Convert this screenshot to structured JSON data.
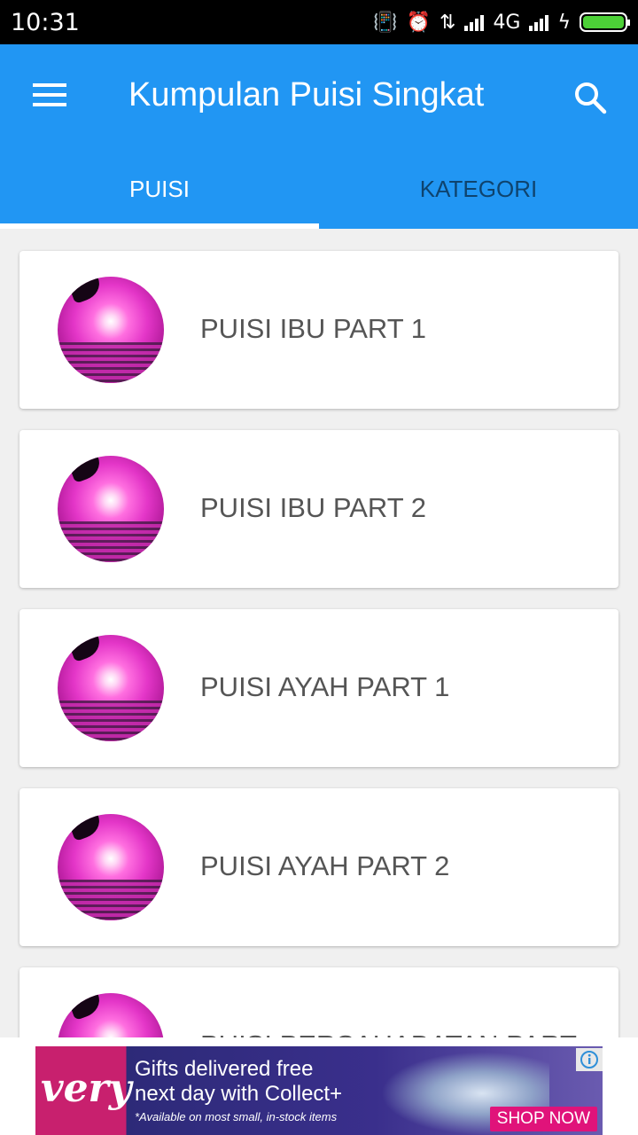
{
  "status_bar": {
    "time": "10:31",
    "network_type": "4G",
    "icons": [
      "vibrate-off-icon",
      "alarm-icon",
      "data-transfer-icon",
      "signal-icon",
      "signal-icon",
      "charging-icon",
      "battery-icon"
    ]
  },
  "app_bar": {
    "title": "Kumpulan Puisi Singkat",
    "background_color": "#2196f3",
    "menu_icon": "hamburger-menu-icon",
    "search_icon": "search-icon"
  },
  "tabs": [
    {
      "label": "PUISI",
      "active": true
    },
    {
      "label": "KATEGORI",
      "active": false
    }
  ],
  "poems": [
    {
      "title": "PUISI IBU PART 1"
    },
    {
      "title": "PUISI IBU PART 2"
    },
    {
      "title": "PUISI AYAH PART 1"
    },
    {
      "title": "PUISI AYAH PART 2"
    },
    {
      "title": "PUISI PERSAHABATAN PART"
    }
  ],
  "ad": {
    "brand": "very",
    "headline_line1": "Gifts delivered free",
    "headline_line2": "next day with Collect+",
    "fine_print": "*Available on most small, in-stock items",
    "cta": "SHOP NOW",
    "info_icon": "info-icon"
  }
}
